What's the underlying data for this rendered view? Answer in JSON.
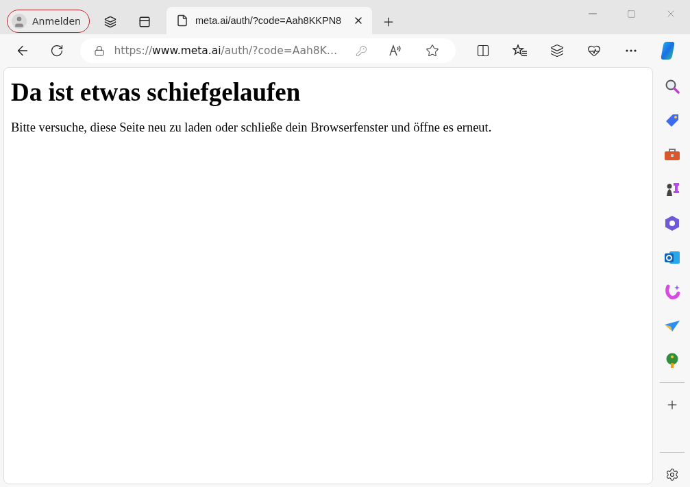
{
  "profile": {
    "label": "Anmelden"
  },
  "tabs": [
    {
      "title": "meta.ai/auth/?code=Aah8KKPN8",
      "selected": true
    }
  ],
  "address_bar": {
    "scheme": "https://",
    "host": "www.meta.ai",
    "path": "/auth/?code=Aah8K…"
  },
  "page": {
    "heading": "Da ist etwas schiefgelaufen",
    "message": "Bitte versuche, diese Seite neu zu laden oder schließe dein Browserfenster und öffne es erneut."
  }
}
